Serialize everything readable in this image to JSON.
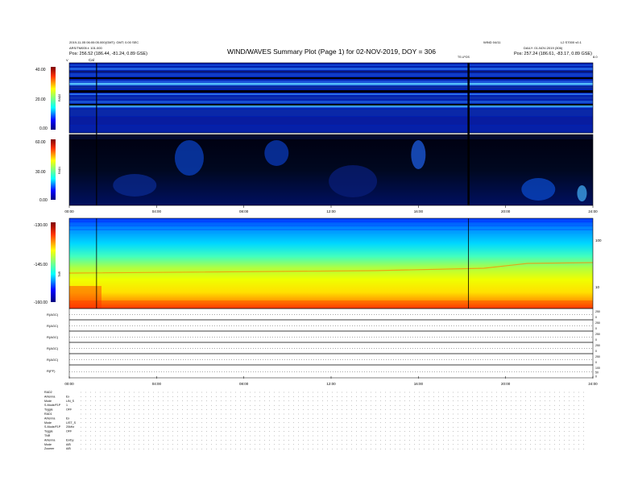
{
  "header": {
    "title": "WIND/WAVES Summary Plot (Page 1) for 02-NOV-2019, DOY = 306",
    "left_line1": "2019-11-05 06:00:05.000(GMT): GMT; 0.00 SEC",
    "left_line2": "ARS/TM005.t: 101.000",
    "left_pos": "Pos: 256.52 (186.44, -81.24, 0.89 GSE)",
    "right_top_left": "WIND 04/11",
    "right_top_right": "L2 S7000 v0.1",
    "right_line2": "DAILY: 01-NOV-2019 (306)",
    "right_pos": "Pos: 257.24 (186.61, -83.17, 0.89 GSE)",
    "cal_marker": "Cal",
    "ts_marker": "TS LPOS",
    "corner_left": "V",
    "corner_right": "8.0"
  },
  "chart_data": [
    {
      "type": "heatmap",
      "name_label": "RAD2",
      "ylabel": "RAD2",
      "yticks": [
        "40.00",
        "20.00",
        "0.00"
      ],
      "ylim": [
        0,
        40
      ],
      "colormap": "jet",
      "vlines_hours": [
        1.25,
        18.3
      ]
    },
    {
      "type": "heatmap",
      "ylabel": "RAD1",
      "yticks": [
        "60.00",
        "30.00",
        "0.00"
      ],
      "ylim": [
        0,
        60
      ],
      "colormap": "jet",
      "xticks": [
        "00:00",
        "04:00",
        "08:00",
        "12:00",
        "16:00",
        "20:00",
        "24:00"
      ],
      "vlines_hours": [
        1.25,
        18.3
      ]
    },
    {
      "type": "heatmap",
      "ylabel": "TNR",
      "yticks": [
        "-130.00",
        "-145.00",
        "-160.00"
      ],
      "ylim": [
        -160,
        -130
      ],
      "right_ticks": [
        "100",
        "10"
      ],
      "colormap": "jet",
      "vlines_hours": [
        1.25,
        18.3
      ]
    },
    {
      "type": "line",
      "rows": [
        {
          "label": "R(AGC)",
          "right": [
            "250",
            "0"
          ]
        },
        {
          "label": "R(AGC)",
          "right": [
            "250",
            "0"
          ]
        },
        {
          "label": "R(AGC)",
          "right": [
            "250",
            "0"
          ]
        },
        {
          "label": "R(AGC)",
          "right": [
            "250",
            "0"
          ]
        },
        {
          "label": "R(AGC)",
          "right": [
            "250",
            "0"
          ]
        },
        {
          "label": "R(FF)",
          "right": [
            "100",
            "50",
            "0"
          ]
        }
      ],
      "xticks": [
        "00:00",
        "04:00",
        "08:00",
        "12:00",
        "16:00",
        "20:00",
        "24:00"
      ]
    }
  ],
  "footer": {
    "rows": [
      {
        "label": "RAD2",
        "value": ""
      },
      {
        "label": "Antenna",
        "value": "Ex"
      },
      {
        "label": "Mode",
        "value": "LIN_S"
      },
      {
        "label": "S-Mode/F1P",
        "value": "1"
      },
      {
        "label": "Toggle",
        "value": "OFF"
      },
      {
        "label": "RAD1",
        "value": ""
      },
      {
        "label": "Antenna",
        "value": "Ex"
      },
      {
        "label": "Mode",
        "value": "LIST_S"
      },
      {
        "label": "S-Mode/F1P",
        "value": "20kHz"
      },
      {
        "label": "Toggle",
        "value": "OFF"
      },
      {
        "label": "TNR",
        "value": ""
      },
      {
        "label": "Antenna",
        "value": "Ex/Ey"
      },
      {
        "label": "Mode",
        "value": "A/B"
      },
      {
        "label": "Zoomer",
        "value": "A/B"
      }
    ]
  },
  "colors": {
    "panel_bg": "#0018a8",
    "band_black": "#000000",
    "axis": "#000000"
  }
}
